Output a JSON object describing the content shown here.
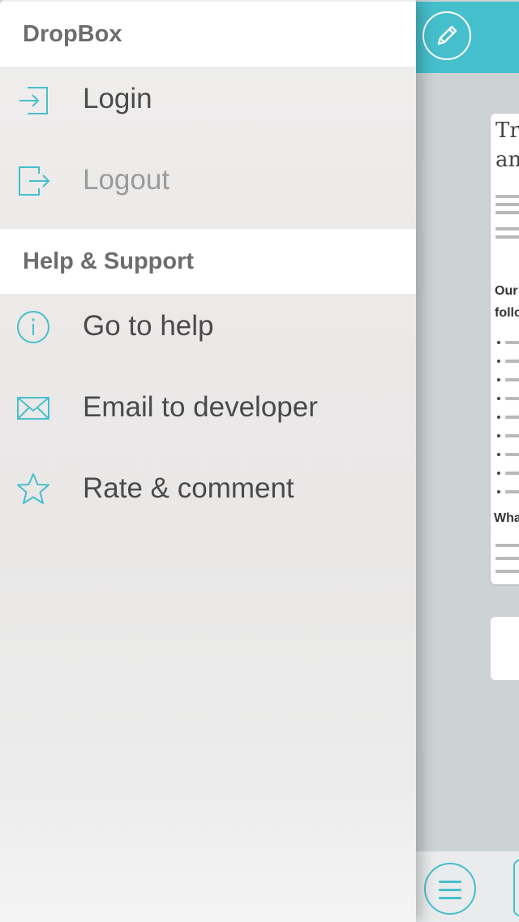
{
  "drawer": {
    "sections": [
      {
        "header": "DropBox",
        "items": [
          {
            "label": "Login",
            "icon": "login-icon",
            "enabled": true
          },
          {
            "label": "Logout",
            "icon": "logout-icon",
            "enabled": false
          }
        ]
      },
      {
        "header": "Help & Support",
        "items": [
          {
            "label": "Go to help",
            "icon": "info-icon",
            "enabled": true
          },
          {
            "label": "Email to developer",
            "icon": "envelope-icon",
            "enabled": true
          },
          {
            "label": "Rate & comment",
            "icon": "star-icon",
            "enabled": true
          }
        ]
      }
    ]
  },
  "main": {
    "topbar_icon": "pencil-icon",
    "bottombar_icon": "hamburger-menu-icon",
    "document_preview": {
      "visible_title_fragments": [
        "Tr",
        "an"
      ],
      "visible_heading_fragments": [
        "Our",
        "follo",
        "Wha"
      ]
    }
  },
  "colors": {
    "accent": "#46bfcc",
    "header_bg": "#ffffff",
    "label_text": "#4a4a4a",
    "disabled_text": "#9a9a9a",
    "header_text": "#6d6d6d"
  }
}
